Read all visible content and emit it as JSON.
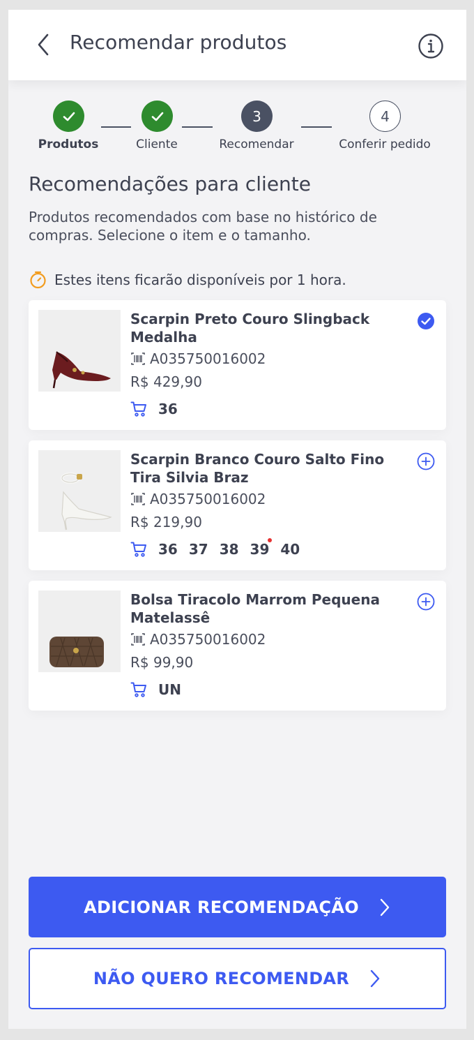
{
  "header": {
    "title": "Recomendar produtos",
    "back_icon": "chevron-left-icon",
    "info_icon": "info-icon"
  },
  "stepper": {
    "steps": [
      {
        "label": "Produtos",
        "status": "done",
        "number": "1"
      },
      {
        "label": "Cliente",
        "status": "done",
        "number": "2"
      },
      {
        "label": "Recomendar",
        "status": "current",
        "number": "3"
      },
      {
        "label": "Conferir pedido",
        "status": "todo",
        "number": "4"
      }
    ]
  },
  "section": {
    "title": "Recomendações para cliente",
    "description": "Produtos recomendados com base no histórico de compras. Selecione o item e o tamanho.",
    "notice": "Estes itens ficarão disponíveis por 1 hora."
  },
  "products": [
    {
      "name": "Scarpin Preto Couro Slingback Medalha",
      "sku": "A035750016002",
      "price": "R$ 429,90",
      "sizes": [
        "36"
      ],
      "selected": true
    },
    {
      "name": "Scarpin Branco Couro Salto Fino Tira Silvia Braz",
      "sku": "A035750016002",
      "price": "R$ 219,90",
      "sizes": [
        "36",
        "37",
        "38",
        "39",
        "40"
      ],
      "selected": false
    },
    {
      "name": "Bolsa Tiracolo Marrom Pequena Matelassê",
      "sku": "A035750016002",
      "price": "R$ 99,90",
      "sizes": [
        "UN"
      ],
      "selected": false
    }
  ],
  "actions": {
    "primary_label": "ADICIONAR RECOMENDAÇÃO",
    "secondary_label": "NÃO QUERO RECOMENDAR"
  },
  "colors": {
    "accent": "#3d5af1",
    "success": "#2e8b2e",
    "step_current": "#4a5163",
    "timer": "#f29c1f",
    "size_dot": "#e63232"
  }
}
